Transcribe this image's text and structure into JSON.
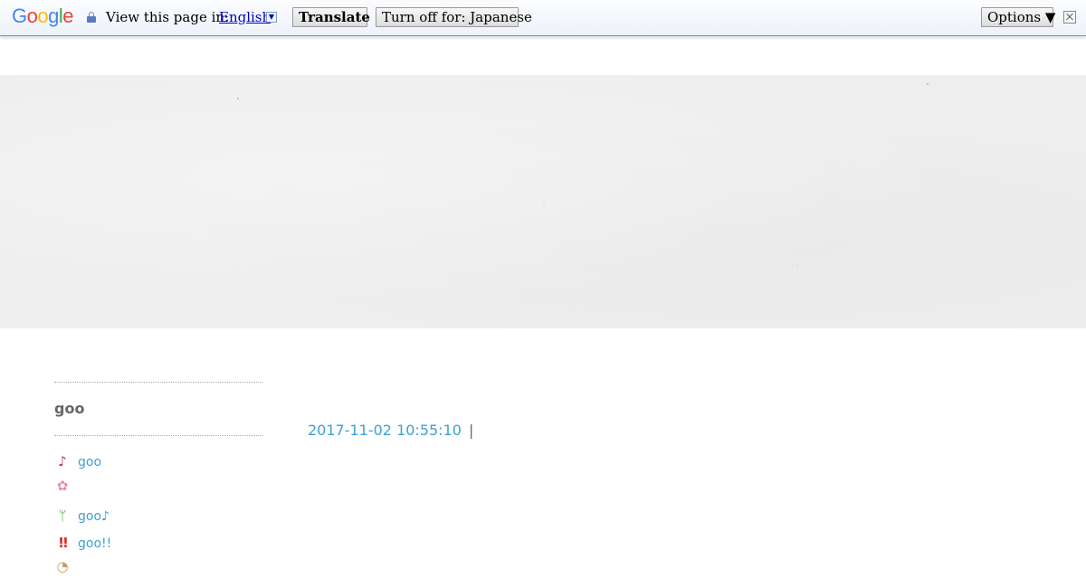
{
  "translate_bar": {
    "logo": "Google",
    "label": "View this page in:",
    "language": "English",
    "dropdown_arrow": "▼",
    "translate_button": "Translate",
    "turn_off_button": "Turn off for: Japanese",
    "options_button": "Options ▼",
    "icons": [
      "lock-icon",
      "close-icon"
    ]
  },
  "sidebar": {
    "title": "goo",
    "items": [
      {
        "icon": "music-note-icon",
        "glyph": "♪",
        "label": "goo"
      },
      {
        "icon": "flower-icon",
        "glyph": "✿",
        "label": ""
      },
      {
        "icon": "sprout-icon",
        "glyph": "ᛘ",
        "label": "goo♪"
      },
      {
        "icon": "double-exclamation-icon",
        "glyph": "!!",
        "label": "goo!!"
      },
      {
        "icon": "egg-icon",
        "glyph": "◔",
        "label": ""
      }
    ]
  },
  "post": {
    "datetime": "2017-11-02 10:55:10",
    "separator": "|"
  }
}
